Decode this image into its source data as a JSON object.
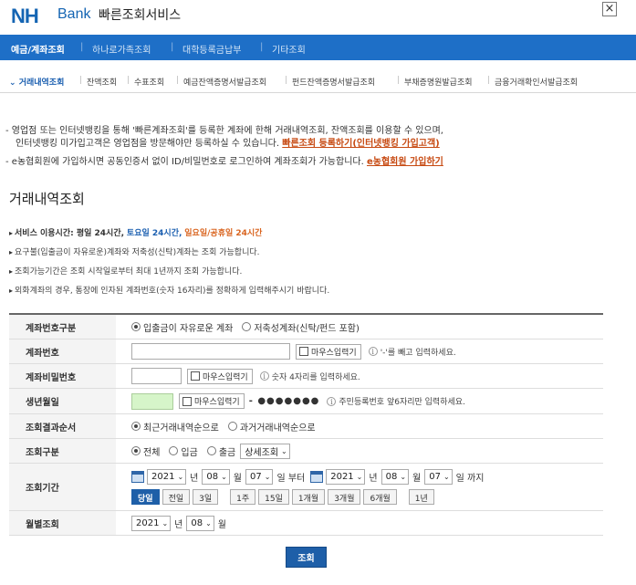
{
  "header": {
    "logo_nh": "NH",
    "logo_bank": "Bank",
    "title": "빠른조회서비스",
    "close": "×"
  },
  "mainnav": [
    "예금/계좌조회",
    "하나로가족조회",
    "대학등록금납부",
    "기타조회"
  ],
  "subnav": [
    "거래내역조회",
    "잔액조회",
    "수표조회",
    "예금잔액증명서발급조회",
    "펀드잔액증명서발급조회",
    "부채증명원발급조회",
    "금융거래확인서발급조회"
  ],
  "notices": {
    "line1": "- 영업점 또는 인터넷뱅킹을 통해 '빠른계좌조회'를 등록한 계좌에 한해 거래내역조회, 잔액조회를 이용할 수 있으며,",
    "line2_text": "인터넷뱅킹 미가입고객은 영업점을 방문해야만 등록하실 수 있습니다.",
    "line2_link": "빠른조회 등록하기(인터넷뱅킹 가입고객)",
    "line3_text": "- e농협회원에 가입하시면 공동인증서 없이 ID/비밀번호로 로그인하여 계좌조회가 가능합니다.",
    "line3_link": "e농협회원 가입하기"
  },
  "section_title": "거래내역조회",
  "info": {
    "service_label": "서비스 이용시간: 평일 24시간,",
    "service_sat": "토요일 24시간,",
    "service_sun": "일요일/공휴일 24시간",
    "line2": "요구불(입출금이 자유로운)계좌와 저축성(신탁)계좌는 조회 가능합니다.",
    "line3": "조회가능기간은 조회 시작일로부터 최대 1년까지 조회 가능합니다.",
    "line4": "외화계좌의 경우, 통장에 인자된 계좌번호(숫자 16자리)를 정확하게 입력해주시기 바랍니다."
  },
  "form": {
    "account_type": {
      "label": "계좌번호구분",
      "opt1": "입출금이 자유로운 계좌",
      "opt2": "저축성계좌(신탁/펀드 포함)"
    },
    "account_no": {
      "label": "계좌번호",
      "mouse": "마우스입력기",
      "hint": "'-'를 빼고 입력하세요."
    },
    "password": {
      "label": "계좌비밀번호",
      "mouse": "마우스입력기",
      "hint": "숫자 4자리를 입력하세요."
    },
    "birth": {
      "label": "생년월일",
      "mouse": "마우스입력기",
      "masked": "- ●●●●●●●",
      "hint": "주민등록번호 앞6자리만 입력하세요."
    },
    "order": {
      "label": "조회결과순서",
      "opt1": "최근거래내역순으로",
      "opt2": "과거거래내역순으로"
    },
    "kind": {
      "label": "조회구분",
      "opt1": "전체",
      "opt2": "입금",
      "opt3": "출금",
      "detail": "상세조회"
    },
    "period": {
      "label": "조회기간",
      "from_year": "2021",
      "from_month": "08",
      "from_day": "07",
      "to_year": "2021",
      "to_month": "08",
      "to_day": "07",
      "year_unit": "년",
      "month_unit": "월",
      "from_suffix": "일 부터",
      "to_suffix": "일 까지",
      "quick": [
        "당일",
        "전일",
        "3일",
        "1주",
        "15일",
        "1개월",
        "3개월",
        "6개월",
        "1년"
      ]
    },
    "monthly": {
      "label": "월별조회",
      "year": "2021",
      "month": "08",
      "year_unit": "년",
      "month_unit": "월"
    }
  },
  "submit": "조회",
  "colors": {
    "brand": "#1e6fc7",
    "link": "#c74a12"
  }
}
